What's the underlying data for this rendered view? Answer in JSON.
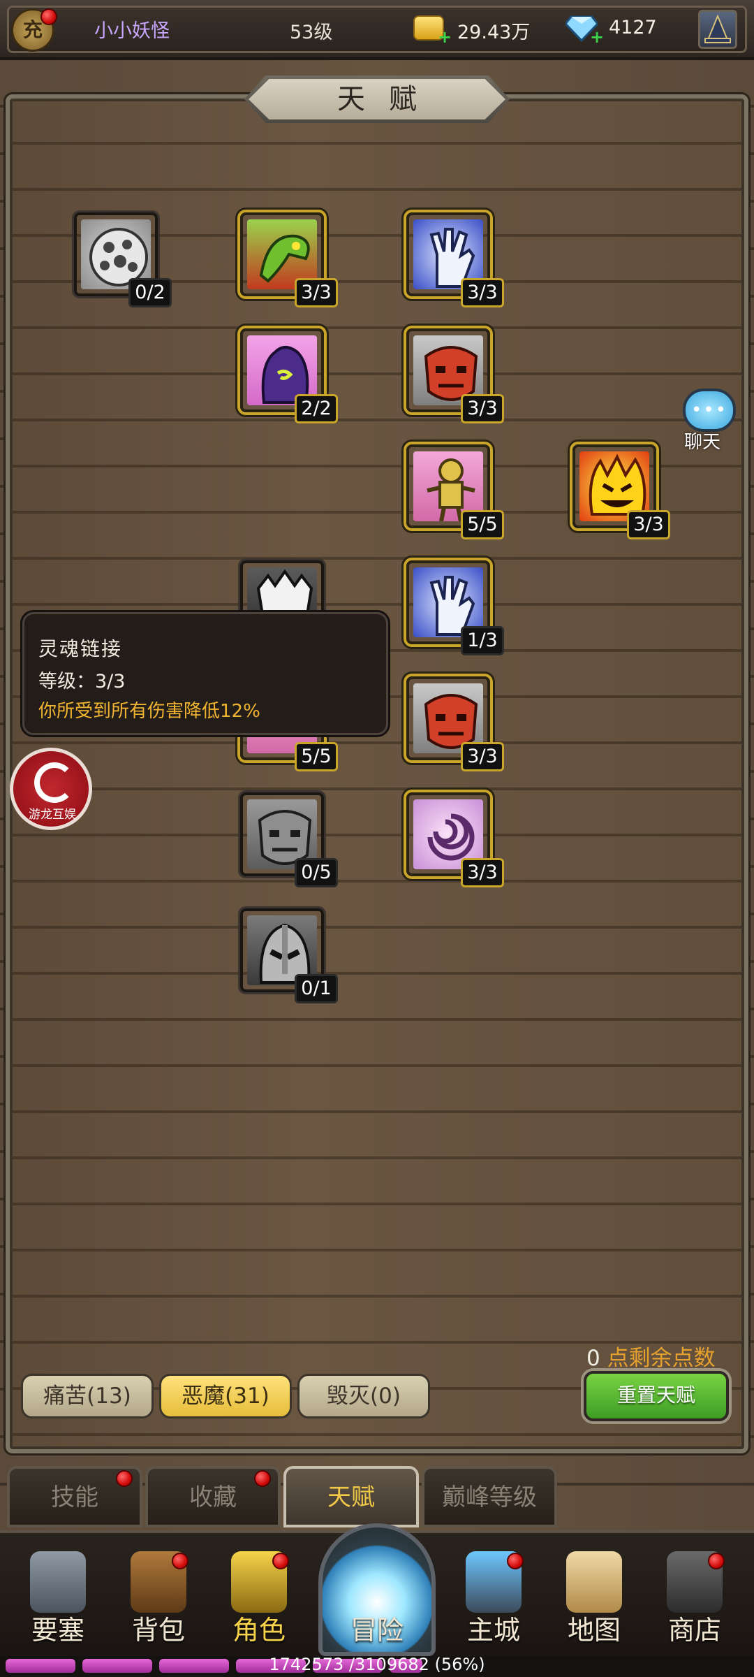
{
  "header": {
    "avatar_char": "充",
    "username": "小小妖怪",
    "level": "53级",
    "gold": "29.43万",
    "gems": "4127",
    "plus": "+"
  },
  "title": "天赋",
  "talents": [
    {
      "level": "0/2",
      "icon": "white-dotted-orb-icon"
    },
    {
      "level": "3/3",
      "icon": "green-serpent-icon"
    },
    {
      "level": "3/3",
      "icon": "blue-claw-hand-icon"
    },
    {
      "level": "2/2",
      "icon": "purple-demon-icon"
    },
    {
      "level": "3/3",
      "icon": "red-demon-mask-icon"
    },
    {
      "level": "5/5",
      "icon": "voodoo-doll-icon"
    },
    {
      "level": "3/3",
      "icon": "fire-demon-face-icon"
    },
    {
      "level": "",
      "icon": "white-demon-face-icon"
    },
    {
      "level": "1/3",
      "icon": "blue-claw-hand-icon"
    },
    {
      "level": "3/3",
      "icon": "red-demon-mask-icon"
    },
    {
      "level": "5/5",
      "icon": "voodoo-doll-icon"
    },
    {
      "level": "0/5",
      "icon": "gray-demon-mask-icon"
    },
    {
      "level": "3/3",
      "icon": "purple-vortex-icon"
    },
    {
      "level": "0/1",
      "icon": "gray-helmet-icon"
    }
  ],
  "tooltip": {
    "name": "灵魂链接",
    "level": "等级：3/3",
    "effect": "你所受到所有伤害降低12%"
  },
  "chat_label": "聊天",
  "logo_text": "游龙互娱",
  "points": {
    "count": "0",
    "label": "点剩余点数"
  },
  "reset_label": "重置天赋",
  "categories": [
    {
      "label": "痛苦(13)",
      "active": false
    },
    {
      "label": "恶魔(31)",
      "active": true
    },
    {
      "label": "毁灭(0)",
      "active": false
    }
  ],
  "section_tabs": [
    {
      "label": "技能"
    },
    {
      "label": "收藏"
    },
    {
      "label": "天赋"
    },
    {
      "label": "巅峰等级"
    }
  ],
  "nav": [
    {
      "label": "要塞"
    },
    {
      "label": "背包"
    },
    {
      "label": "角色"
    },
    {
      "label": "冒险"
    },
    {
      "label": "主城"
    },
    {
      "label": "地图"
    },
    {
      "label": "商店"
    }
  ],
  "xp": {
    "text": "1742573 /3109682 (56%)",
    "fraction": 0.56
  },
  "colors": {
    "accent": "#f2b531",
    "reset_green": "#4fb22d",
    "active_tab": "#f6d34a"
  }
}
